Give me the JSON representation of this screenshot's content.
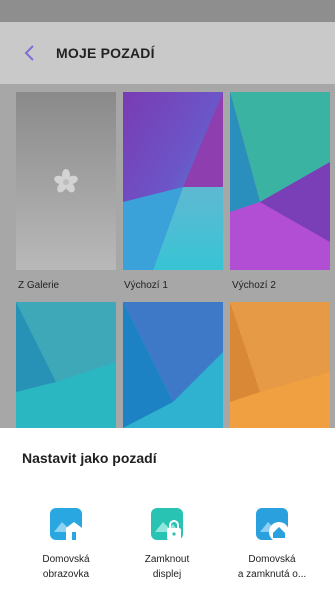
{
  "header": {
    "title": "MOJE POZADÍ",
    "back_icon": "chevron-left-icon"
  },
  "wallpapers": [
    {
      "label": "Z Galerie",
      "icon": "flower-icon"
    },
    {
      "label": "Výchozí 1"
    },
    {
      "label": "Výchozí 2"
    }
  ],
  "sheet": {
    "title": "Nastavit jako pozadí",
    "options": [
      {
        "line1": "Domovská",
        "line2": "obrazovka",
        "icon": "home-image-icon"
      },
      {
        "line1": "Zamknout",
        "line2": "displej",
        "icon": "lock-image-icon"
      },
      {
        "line1": "Domovská",
        "line2": "a zamknutá o...",
        "icon": "home-lock-image-icon"
      }
    ]
  },
  "colors": {
    "accent": "#5a7bdc",
    "sheet_icon": "#29a7e0"
  }
}
